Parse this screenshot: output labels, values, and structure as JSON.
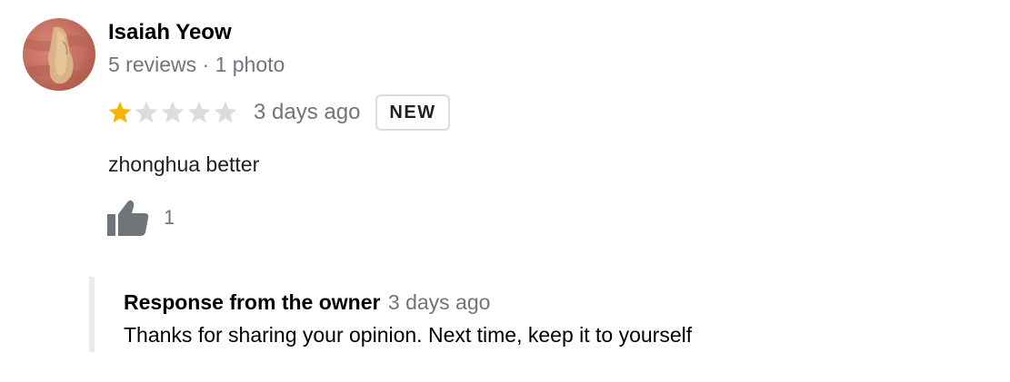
{
  "review": {
    "author": {
      "name": "Isaiah Yeow",
      "meta": "5 reviews · 1 photo",
      "avatar_icon": "profile-photo"
    },
    "rating": {
      "value": 1,
      "max": 5,
      "filled_color": "#f4b400",
      "empty_color": "#dadce0"
    },
    "date": "3 days ago",
    "badge": "NEW",
    "text": "zhonghua better",
    "likes": {
      "icon": "thumbs-up-icon",
      "count": "1"
    },
    "owner_response": {
      "title": "Response from the owner",
      "date": "3 days ago",
      "text": "Thanks for sharing your opinion. Next time, keep it to yourself"
    }
  }
}
